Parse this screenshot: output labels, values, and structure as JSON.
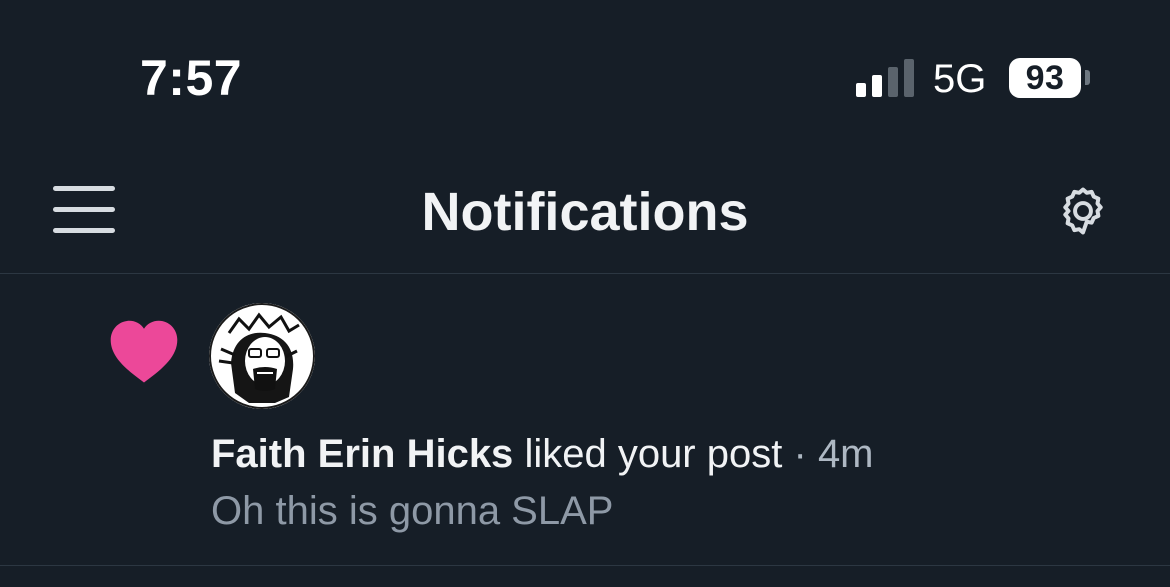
{
  "status_bar": {
    "time": "7:57",
    "network": "5G",
    "battery_level": "93",
    "signal_bars_active": 2,
    "signal_bars_total": 4
  },
  "header": {
    "title": "Notifications",
    "menu_icon": "hamburger-menu-icon",
    "settings_icon": "gear-icon"
  },
  "notifications": [
    {
      "type_icon": "heart-icon",
      "type_color": "#ec4899",
      "author": "Faith Erin Hicks",
      "action": "liked your post",
      "separator": "·",
      "time": "4m",
      "preview": "Oh this is gonna SLAP"
    }
  ],
  "colors": {
    "background": "#161e27",
    "text_primary": "#f1f3f5",
    "text_secondary": "#8e99a6",
    "divider": "#2c3742",
    "like_accent": "#ec4899"
  }
}
